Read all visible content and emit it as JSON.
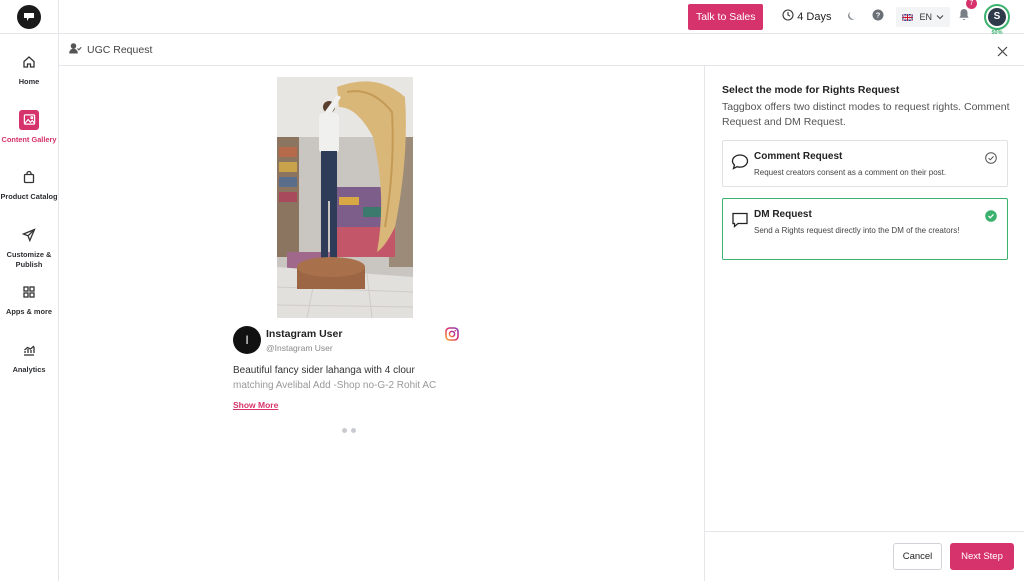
{
  "sidebar": {
    "items": [
      {
        "label": "Home",
        "icon": "home-icon"
      },
      {
        "label": "Content Gallery",
        "icon": "gallery-icon",
        "active": true
      },
      {
        "label": "Product Catalog",
        "icon": "shopping-bag-icon"
      },
      {
        "label": "Customize & Publish",
        "icon": "send-icon"
      },
      {
        "label": "Apps & more",
        "icon": "grid-icon"
      },
      {
        "label": "Analytics",
        "icon": "analytics-icon"
      }
    ]
  },
  "topbar": {
    "talk_to_sales": "Talk to Sales",
    "days": "4 Days",
    "language": "EN",
    "notification_count": "7",
    "avatar_initial": "S",
    "profile_progress": "50%"
  },
  "page": {
    "title": "UGC Request"
  },
  "post": {
    "user_initial": "I",
    "user_name": "Instagram User",
    "user_handle": "@Instagram User",
    "caption_line1": "Beautiful fancy sider lahanga with 4 clour",
    "caption_line2": "matching Avelibal Add -Shop no-G-2 Rohit AC",
    "show_more": "Show More"
  },
  "rights": {
    "title": "Select the mode for Rights Request",
    "description": "Taggbox offers two distinct modes to request rights. Comment Request and DM Request.",
    "options": [
      {
        "title": "Comment Request",
        "description": "Request creators consent as a comment on their post.",
        "selected": false
      },
      {
        "title": "DM Request",
        "description": "Send a Rights request directly into the DM of the creators!",
        "selected": true
      }
    ]
  },
  "footer": {
    "cancel": "Cancel",
    "next": "Next Step"
  },
  "colors": {
    "accent": "#d6336c",
    "success": "#3ab26e"
  }
}
